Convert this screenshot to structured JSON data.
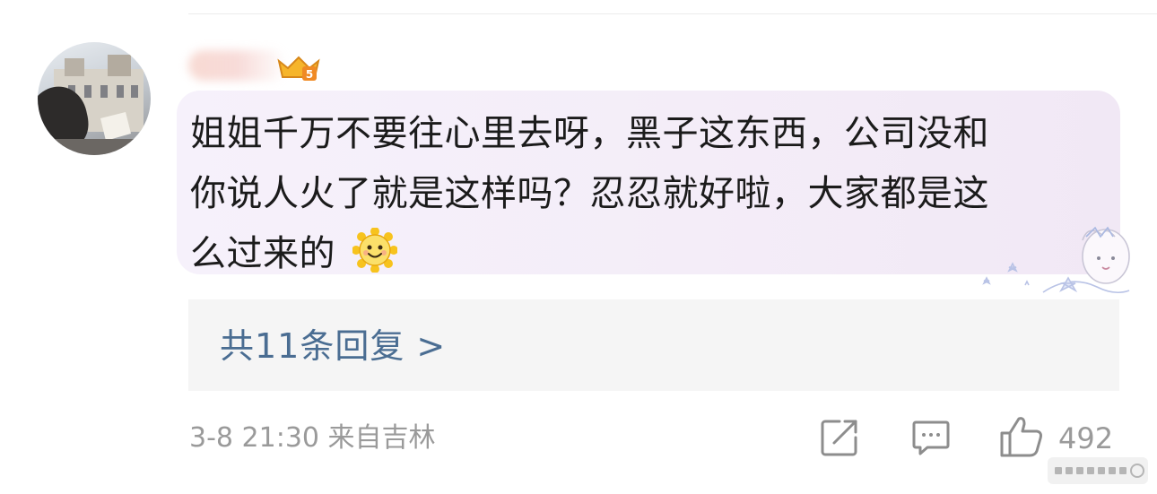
{
  "comment": {
    "text_lines": [
      "姐姐千万不要往心里去呀，黑子这东西，公司没和",
      "你说人火了就是这样吗？忍忍就好啦，大家都是这",
      "么过来的"
    ],
    "emoji": "sun-smile-icon"
  },
  "replies": {
    "label": "共11条回复 >"
  },
  "meta": {
    "date_location": "3-8 21:30  来自吉林"
  },
  "actions": {
    "likes": "492"
  },
  "colors": {
    "bubble": "#f4edf8",
    "reply_link": "#4a6d92",
    "meta_gray": "#9a9a9a",
    "text": "#1b1b1b"
  },
  "icons": [
    "avatar",
    "vip-badge-icon",
    "sun-smile-icon",
    "sticker-decoration",
    "share-icon",
    "comment-icon",
    "like-icon"
  ]
}
